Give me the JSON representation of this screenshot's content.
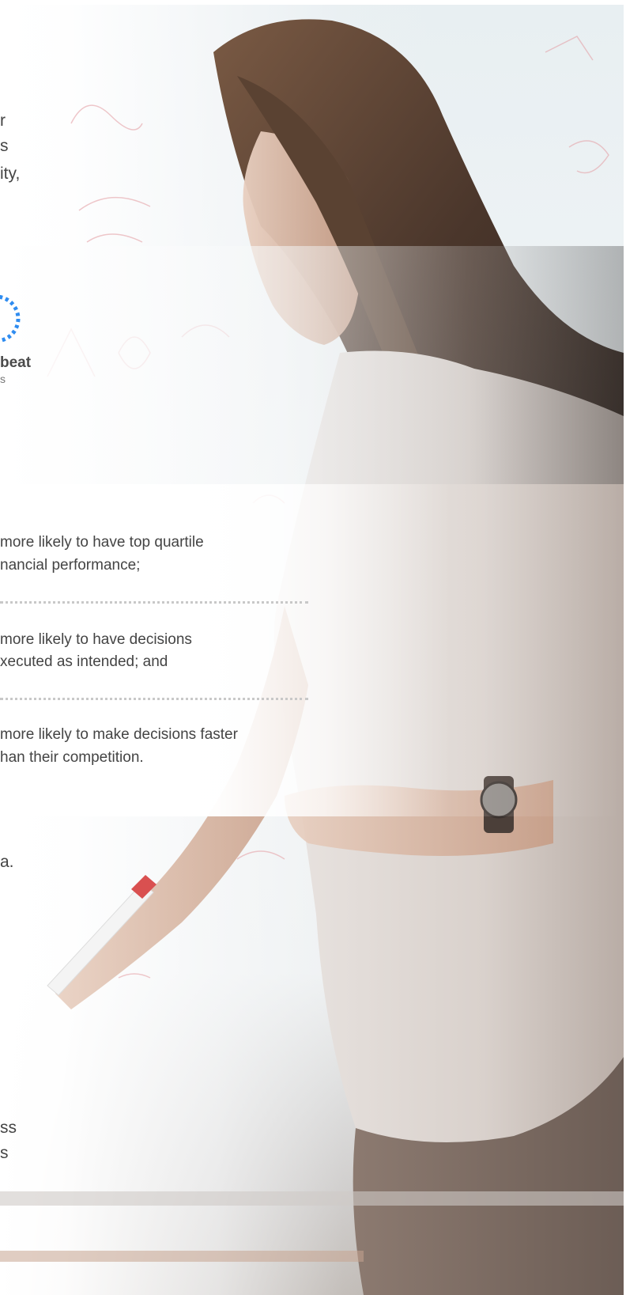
{
  "intro": {
    "lines": [
      "r",
      "s",
      "ity,"
    ]
  },
  "callout": {
    "label_line1": "beat",
    "label_line2": "s",
    "ring_color": "#2f8cf0"
  },
  "stats": [
    {
      "line1": "more likely to have top quartile",
      "line2": "nancial performance;"
    },
    {
      "line1": "more likely to have decisions",
      "line2": "xecuted as intended; and"
    },
    {
      "line1": "more likely to make decisions faster",
      "line2": "han their competition."
    }
  ],
  "body": {
    "line1": "a."
  },
  "footer": {
    "lines": [
      "ss",
      "s"
    ]
  }
}
